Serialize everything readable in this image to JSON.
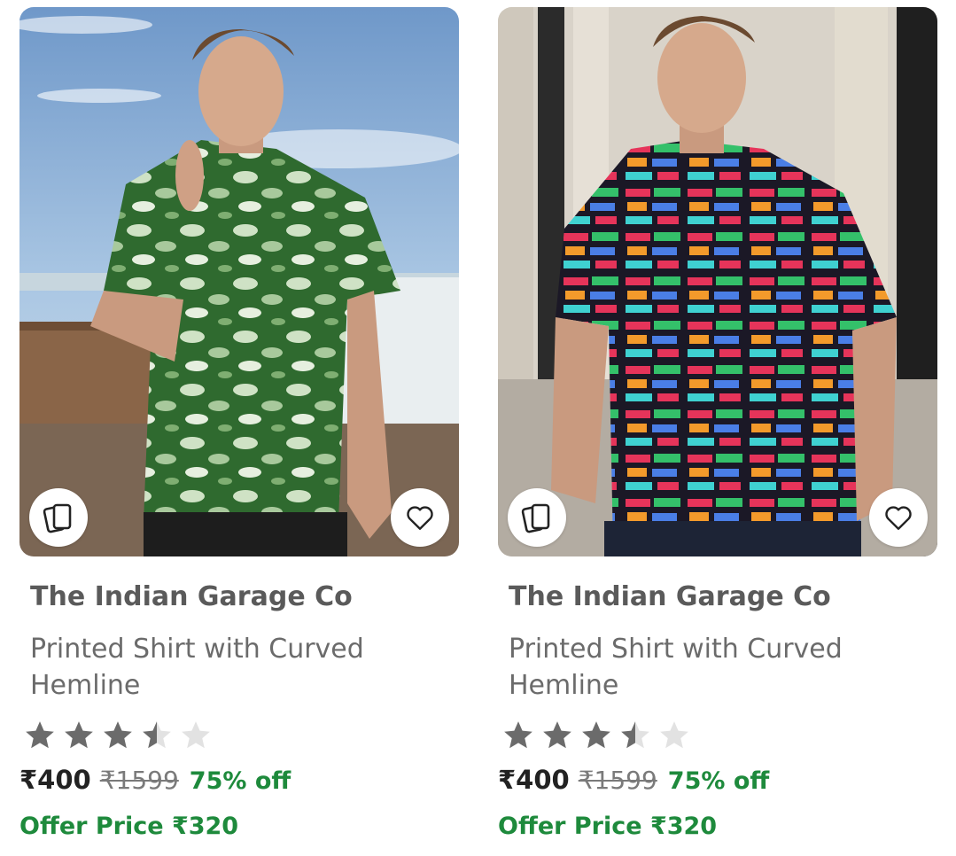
{
  "products": [
    {
      "brand": "The Indian Garage Co",
      "title": "Printed Shirt with Curved Hemline",
      "rating": 3.5,
      "price": "₹400",
      "mrp": "₹1599",
      "discount": "75% off",
      "offer_label": "Offer Price",
      "offer_price": "₹320",
      "similar_icon": "similar-products-icon",
      "wishlist_icon": "heart-icon",
      "shirt_color": "#3f7a3a"
    },
    {
      "brand": "The Indian Garage Co",
      "title": "Printed Shirt with Curved Hemline",
      "rating": 3.5,
      "price": "₹400",
      "mrp": "₹1599",
      "discount": "75% off",
      "offer_label": "Offer Price",
      "offer_price": "₹320",
      "similar_icon": "similar-products-icon",
      "wishlist_icon": "heart-icon",
      "shirt_color": "#1e1a2a"
    }
  ],
  "colors": {
    "discount_green": "#1e8a3c",
    "star_filled": "#6b6b6b",
    "star_empty": "#e2e2e2"
  }
}
